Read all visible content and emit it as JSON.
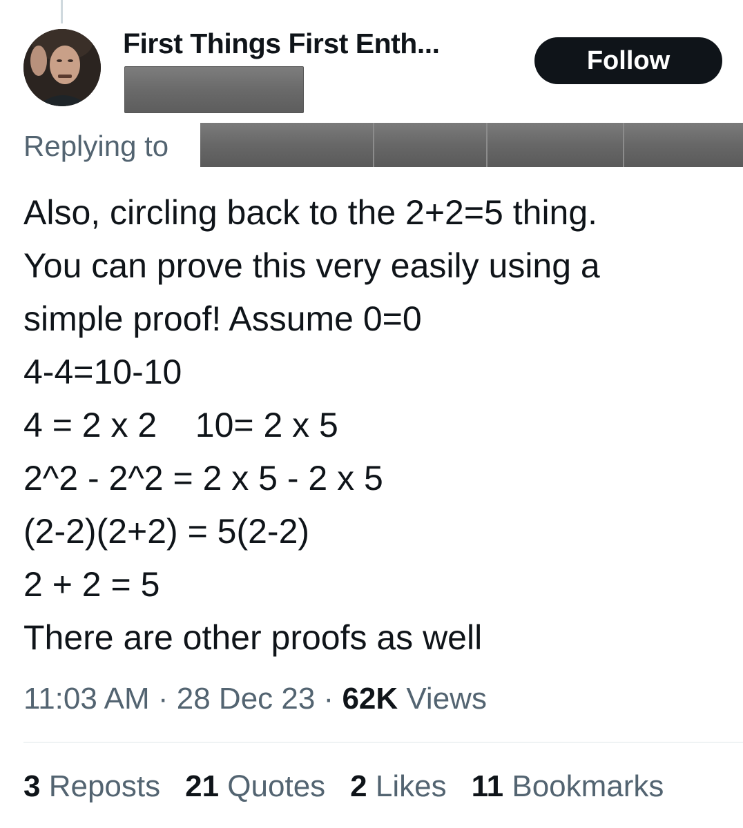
{
  "author": {
    "display_name": "First Things First Enth...",
    "handle": ""
  },
  "follow_button": {
    "label": "Follow"
  },
  "reply_context": {
    "label": "Replying to"
  },
  "tweet": {
    "lines": [
      "Also, circling back to the 2+2=5 thing.",
      "You can prove this very easily using a",
      "simple proof! Assume 0=0",
      "4-4=10-10",
      "4 = 2 x 2    10= 2 x 5",
      "2^2 - 2^2 = 2 x 5 - 2 x 5",
      "(2-2)(2+2) = 5(2-2)",
      "2 + 2 = 5",
      "There are other proofs as well"
    ]
  },
  "meta": {
    "time": "11:03 AM",
    "separator": " · ",
    "date": "28 Dec 23",
    "views_count": "62K",
    "views_label": " Views"
  },
  "stats": [
    {
      "count": "3",
      "label": " Reposts"
    },
    {
      "count": "21",
      "label": " Quotes"
    },
    {
      "count": "2",
      "label": " Likes"
    },
    {
      "count": "11",
      "label": " Bookmarks"
    }
  ],
  "colors": {
    "text_primary": "#0f1419",
    "text_secondary": "#536471",
    "button_bg": "#0f1419",
    "divider": "#eff3f4"
  }
}
